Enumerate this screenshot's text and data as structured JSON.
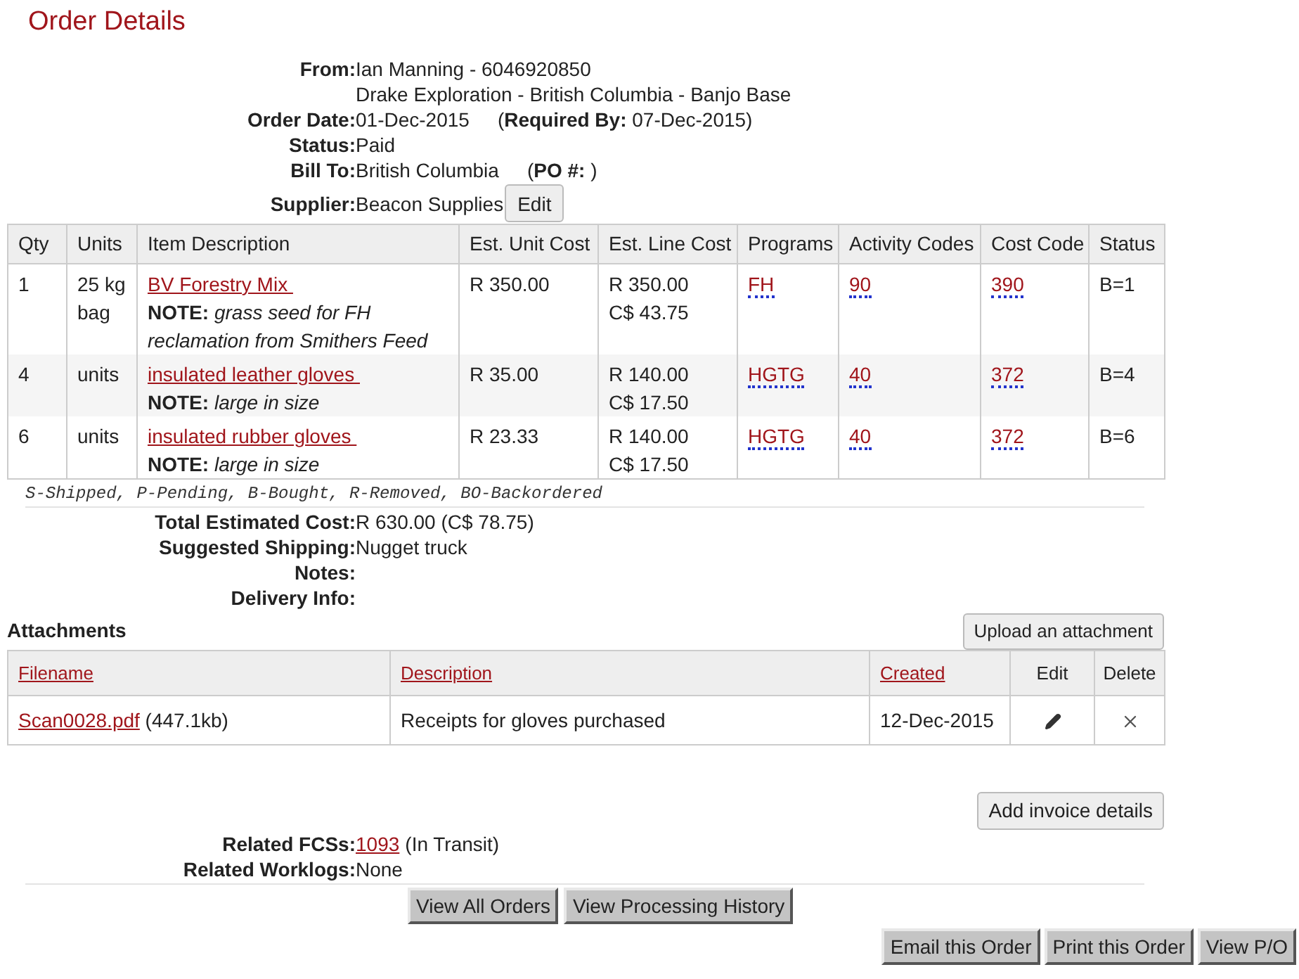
{
  "title": "Order Details",
  "header_fields": [
    {
      "label": "From:",
      "lines": [
        "Ian Manning - 6046920850",
        "Drake Exploration - British Columbia - Banjo Base"
      ]
    },
    {
      "label": "Order Date:",
      "lines": [
        "01-Dec-2015"
      ],
      "extra": "(**Required By:** 07-Dec-2015)"
    },
    {
      "label": "Status:",
      "lines": [
        "Paid"
      ]
    },
    {
      "label": "Bill To:",
      "lines": [
        "British Columbia"
      ],
      "extra": "(**PO #:** )"
    },
    {
      "label": "Supplier:",
      "lines": [
        "Beacon Supplies"
      ],
      "button": "Edit"
    }
  ],
  "items_table": {
    "columns": [
      "Qty",
      "Units",
      "Item Description",
      "Est. Unit Cost",
      "Est. Line Cost",
      "Programs",
      "Activity Codes",
      "Cost Code",
      "Status"
    ],
    "rows": [
      {
        "qty": "1",
        "units": "25 kg bag",
        "description": "BV Forestry Mix",
        "note_label": "NOTE:",
        "note": "grass seed for FH reclamation from Smithers Feed",
        "unit_cost": "R 350.00",
        "line_cost": [
          "R 350.00",
          "C$ 43.75"
        ],
        "program": "FH",
        "activity_code": "90",
        "cost_code": "390",
        "status": "B=1"
      },
      {
        "qty": "4",
        "units": "units",
        "description": "insulated leather gloves",
        "note_label": "NOTE:",
        "note": "large in size",
        "unit_cost": "R 35.00",
        "line_cost": [
          "R 140.00",
          "C$ 17.50"
        ],
        "program": "HGTG",
        "activity_code": "40",
        "cost_code": "372",
        "status": "B=4"
      },
      {
        "qty": "6",
        "units": "units",
        "description": "insulated rubber gloves",
        "note_label": "NOTE:",
        "note": "large in size",
        "unit_cost": "R 23.33",
        "line_cost": [
          "R 140.00",
          "C$ 17.50"
        ],
        "program": "HGTG",
        "activity_code": "40",
        "cost_code": "372",
        "status": "B=6"
      }
    ]
  },
  "legend": "S-Shipped, P-Pending, B-Bought, R-Removed, BO-Backordered",
  "summary_fields": [
    {
      "label": "Total Estimated Cost:",
      "value": "R 630.00 (C$ 78.75)"
    },
    {
      "label": "Suggested Shipping:",
      "value": "Nugget truck"
    },
    {
      "label": "Notes:"
    },
    {
      "label": "Delivery Info:"
    }
  ],
  "attachments": {
    "title": "Attachments",
    "upload_button": "Upload an attachment",
    "columns": [
      {
        "label": "Filename",
        "sortable": true
      },
      {
        "label": "Description",
        "sortable": true
      },
      {
        "label": "Created",
        "sortable": true
      },
      {
        "label": "Edit",
        "sortable": false
      },
      {
        "label": "Delete",
        "sortable": false
      }
    ],
    "rows": [
      {
        "filename": "Scan0028.pdf",
        "size": "(447.1kb)",
        "description": "Receipts for gloves purchased",
        "created": "12-Dec-2015"
      }
    ]
  },
  "invoice_button": "Add invoice details",
  "related": [
    {
      "label": "Related FCSs:",
      "link": "1093",
      "value": "(In Transit)"
    },
    {
      "label": "Related Worklogs:",
      "value": "None"
    }
  ],
  "nav_buttons": [
    "View All Orders",
    "View Processing History"
  ],
  "action_buttons": [
    "Email this Order",
    "Print this Order",
    "View P/O"
  ]
}
